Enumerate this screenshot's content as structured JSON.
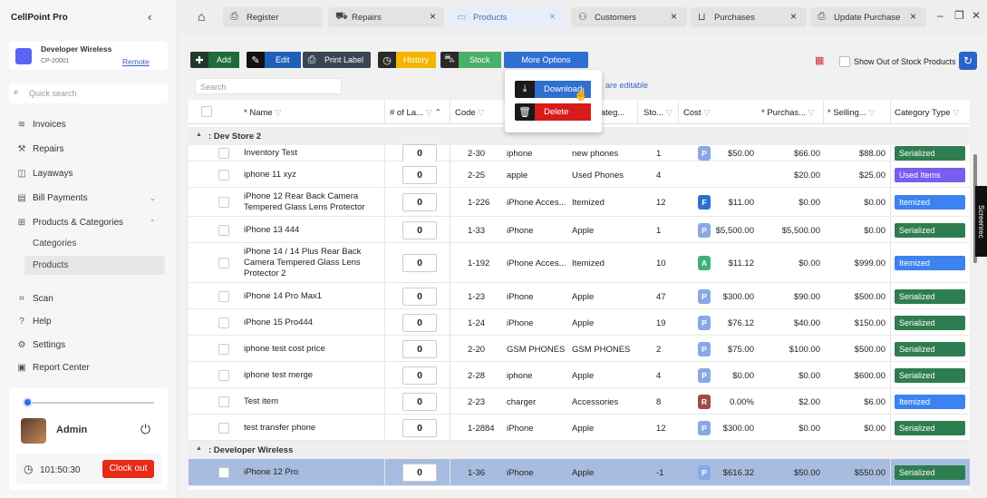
{
  "app": {
    "title": "CellPoint Pro",
    "collapse_icon": "chevron-left-icon"
  },
  "store": {
    "name": "Developer Wireless",
    "code": "CP-20001",
    "remote_link": "Remote",
    "color": "#5b63f5"
  },
  "sidebar": {
    "search_placeholder": "Quick search",
    "items": [
      {
        "label": "Invoices",
        "icon": "invoices-icon"
      },
      {
        "label": "Repairs",
        "icon": "repairs-icon"
      },
      {
        "label": "Layaways",
        "icon": "layaways-icon"
      },
      {
        "label": "Bill Payments",
        "icon": "bill-payments-icon"
      },
      {
        "label": "Products & Categories",
        "icon": "products-icon"
      }
    ],
    "sub_items": [
      {
        "label": "Categories"
      },
      {
        "label": "Products"
      }
    ],
    "bottom_items": [
      {
        "label": "Scan",
        "icon": "scan-icon"
      },
      {
        "label": "Help",
        "icon": "help-icon"
      },
      {
        "label": "Settings",
        "icon": "settings-icon"
      },
      {
        "label": "Report Center",
        "icon": "report-icon"
      }
    ]
  },
  "user": {
    "name": "Admin",
    "timer": "101:50:30",
    "clock_out": "Clock out"
  },
  "tabs": [
    {
      "label": "Register"
    },
    {
      "label": "Repairs"
    },
    {
      "label": "Products"
    },
    {
      "label": "Customers"
    },
    {
      "label": "Purchases"
    },
    {
      "label": "Update Purchase"
    }
  ],
  "toolbar": {
    "add": "Add",
    "edit": "Edit",
    "print_label": "Print Label",
    "history": "History",
    "stock": "Stock",
    "more_options": "More Options",
    "show_oos": "Show Out of Stock Products",
    "search_placeholder": "Search",
    "editable_note": "are editable"
  },
  "dropdown": {
    "download": "Download",
    "delete": "Delete"
  },
  "columns": [
    "* Name",
    "# of La...",
    "Code",
    "Categ...",
    "Sto...",
    "Cost",
    "* Purchas...",
    "* Selling...",
    "Category Type"
  ],
  "groups": [
    ": Dev Store 2",
    ": Developer Wireless"
  ],
  "rows": [
    {
      "name": "Inventory Test",
      "qty": "0",
      "code": "2-30",
      "cat": "iphone",
      "categ": "new phones",
      "stock": "1",
      "pill": "P",
      "cost": "$50.00",
      "purchase": "$66.00",
      "selling": "$88.00",
      "type": "Serialized"
    },
    {
      "name": "iphone 11 xyz",
      "qty": "0",
      "code": "2-25",
      "cat": "apple",
      "categ": "Used Phones",
      "stock": "4",
      "pill": "",
      "cost": "",
      "purchase": "$20.00",
      "selling": "$25.00",
      "type": "Used Items"
    },
    {
      "name": "iPhone 12 Rear Back Camera Tempered Glass Lens Protector",
      "qty": "0",
      "code": "1-226",
      "cat": "iPhone Acces...",
      "categ": "Itemized",
      "stock": "12",
      "pill": "F",
      "cost": "$11.00",
      "purchase": "$0.00",
      "selling": "$0.00",
      "type": "Itemized"
    },
    {
      "name": "iPhone 13 444",
      "qty": "0",
      "code": "1-33",
      "cat": "iPhone",
      "categ": "Apple",
      "stock": "1",
      "pill": "P",
      "cost": "$5,500.00",
      "purchase": "$5,500.00",
      "selling": "$0.00",
      "type": "Serialized"
    },
    {
      "name": "iPhone 14 / 14 Plus Rear Back Camera Tempered Glass Lens Protector 2",
      "qty": "0",
      "code": "1-192",
      "cat": "iPhone Acces...",
      "categ": "Itemized",
      "stock": "10",
      "pill": "A",
      "cost": "$11.12",
      "purchase": "$0.00",
      "selling": "$999.00",
      "type": "Itemized"
    },
    {
      "name": "iPhone 14 Pro Max1",
      "qty": "0",
      "code": "1-23",
      "cat": "iPhone",
      "categ": "Apple",
      "stock": "47",
      "pill": "P",
      "cost": "$300.00",
      "purchase": "$90.00",
      "selling": "$500.00",
      "type": "Serialized"
    },
    {
      "name": "iPhone 15 Pro444",
      "qty": "0",
      "code": "1-24",
      "cat": "iPhone",
      "categ": "Apple",
      "stock": "19",
      "pill": "P",
      "cost": "$76.12",
      "purchase": "$40.00",
      "selling": "$150.00",
      "type": "Serialized"
    },
    {
      "name": "iphone test cost price",
      "qty": "0",
      "code": "2-20",
      "cat": "GSM PHONES",
      "categ": "GSM PHONES",
      "stock": "2",
      "pill": "P",
      "cost": "$75.00",
      "purchase": "$100.00",
      "selling": "$500.00",
      "type": "Serialized"
    },
    {
      "name": "iphone test merge",
      "qty": "0",
      "code": "2-28",
      "cat": "iphone",
      "categ": "Apple",
      "stock": "4",
      "pill": "P",
      "cost": "$0.00",
      "purchase": "$0.00",
      "selling": "$600.00",
      "type": "Serialized"
    },
    {
      "name": "Test item",
      "qty": "0",
      "code": "2-23",
      "cat": "charger",
      "categ": "Accessories",
      "stock": "8",
      "pill": "R",
      "cost": "0.00%",
      "purchase": "$2.00",
      "selling": "$6.00",
      "type": "Itemized"
    },
    {
      "name": "test transfer phone",
      "qty": "0",
      "code": "1-2884",
      "cat": "iPhone",
      "categ": "Apple",
      "stock": "12",
      "pill": "P",
      "cost": "$300.00",
      "purchase": "$0.00",
      "selling": "$0.00",
      "type": "Serialized"
    },
    {
      "name": "iPhone 12 Pro",
      "qty": "0",
      "code": "1-36",
      "cat": "iPhone",
      "categ": "Apple",
      "stock": "-1",
      "pill": "P",
      "cost": "$616.32",
      "purchase": "$50.00",
      "selling": "$550.00",
      "type": "Serialized"
    }
  ],
  "colors": {
    "serialized": "#2e7d4f",
    "itemized": "#3c82f0",
    "used_items": "#7a5cf0",
    "pill_p": "#8aa8e6",
    "pill_f": "#2f6fd0",
    "pill_a": "#3eb07a",
    "pill_r": "#a04a4a",
    "add": "#1f6b3a",
    "edit": "#1f5fb8",
    "print": "#3a4452",
    "history": "#f5b400",
    "stock": "#4caf6a",
    "more": "#2f6fd0"
  },
  "screenrec": "Screenrec"
}
